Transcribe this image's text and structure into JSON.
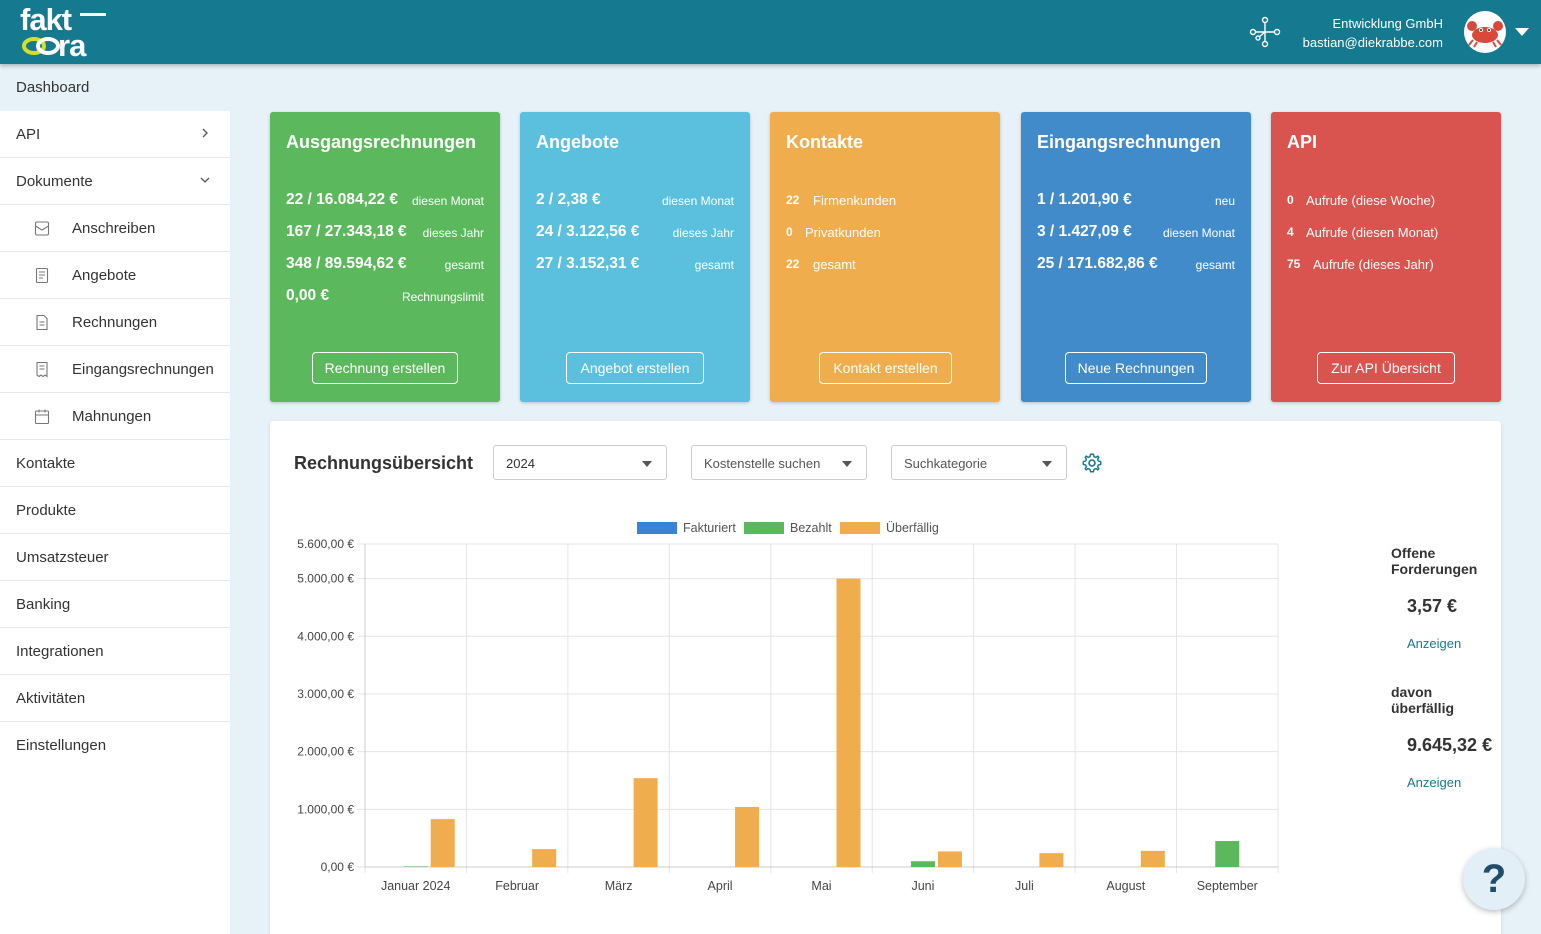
{
  "brand": {
    "logo_top": "fakt",
    "logo_bottom": "ra"
  },
  "header": {
    "company": "Entwicklung GmbH",
    "email": "bastian@diekrabbe.com"
  },
  "sidebar": {
    "dashboard": "Dashboard",
    "api": "API",
    "dokumente": "Dokumente",
    "sub": [
      "Anschreiben",
      "Angebote",
      "Rechnungen",
      "Eingangsrechnungen",
      "Mahnungen"
    ],
    "items": [
      "Kontakte",
      "Produkte",
      "Umsatzsteuer",
      "Banking",
      "Integrationen",
      "Aktivitäten",
      "Einstellungen"
    ]
  },
  "cards": {
    "ausgang": {
      "title": "Ausgangsrechnungen",
      "rows": [
        {
          "value": "22 / 16.084,22 €",
          "label": "diesen Monat"
        },
        {
          "value": "167 / 27.343,18 €",
          "label": "dieses Jahr"
        },
        {
          "value": "348 / 89.594,62 €",
          "label": "gesamt"
        },
        {
          "value": "0,00 €",
          "label": "Rechnungslimit"
        }
      ],
      "button": "Rechnung erstellen",
      "color": "#5cb85c"
    },
    "angebote": {
      "title": "Angebote",
      "rows": [
        {
          "value": "2 / 2,38 €",
          "label": "diesen Monat"
        },
        {
          "value": "24 / 3.122,56 €",
          "label": "dieses Jahr"
        },
        {
          "value": "27 / 3.152,31 €",
          "label": "gesamt"
        }
      ],
      "button": "Angebot erstellen",
      "color": "#5bc0de"
    },
    "kontakte": {
      "title": "Kontakte",
      "rows": [
        {
          "value": "22",
          "label": "Firmenkunden"
        },
        {
          "value": "0",
          "label": "Privatkunden"
        },
        {
          "value": "22",
          "label": "gesamt"
        }
      ],
      "button": "Kontakt erstellen",
      "color": "#f0ad4e"
    },
    "eingang": {
      "title": "Eingangsrechnungen",
      "rows": [
        {
          "value": "1 / 1.201,90 €",
          "label": "neu"
        },
        {
          "value": "3 / 1.427,09 €",
          "label": "diesen Monat"
        },
        {
          "value": "25 / 171.682,86 €",
          "label": "gesamt"
        }
      ],
      "button": "Neue Rechnungen",
      "color": "#428bca"
    },
    "api": {
      "title": "API",
      "rows": [
        {
          "value": "0",
          "label": "Aufrufe (diese Woche)"
        },
        {
          "value": "4",
          "label": "Aufrufe (diesen Monat)"
        },
        {
          "value": "75",
          "label": "Aufrufe (dieses Jahr)"
        }
      ],
      "button": "Zur API Übersicht",
      "color": "#d9534f"
    }
  },
  "panel": {
    "title": "Rechnungsübersicht",
    "year_select": "2024",
    "cost_placeholder": "Kostenstelle suchen",
    "category_placeholder": "Suchkategorie"
  },
  "summary": {
    "open_label": "Offene Forderungen",
    "open_value": "3,57 €",
    "open_link": "Anzeigen",
    "overdue_label": "davon überfällig",
    "overdue_value": "9.645,32 €",
    "overdue_link": "Anzeigen"
  },
  "help": "?",
  "chart_data": {
    "type": "bar",
    "categories": [
      "Januar 2024",
      "Februar",
      "März",
      "April",
      "Mai",
      "Juni",
      "Juli",
      "August",
      "September"
    ],
    "series": [
      {
        "name": "Fakturiert",
        "color": "#3a82d6",
        "values": [
          0,
          0,
          0,
          0,
          0,
          0,
          0,
          0,
          0
        ]
      },
      {
        "name": "Bezahlt",
        "color": "#5cb85c",
        "values": [
          10,
          0,
          0,
          0,
          0,
          100,
          0,
          0,
          450
        ]
      },
      {
        "name": "Überfällig",
        "color": "#f0ad4e",
        "values": [
          830,
          310,
          1540,
          1040,
          5000,
          270,
          240,
          280,
          0
        ]
      }
    ],
    "y_ticks": [
      "0,00 €",
      "1.000,00 €",
      "2.000,00 €",
      "3.000,00 €",
      "4.000,00 €",
      "5.000,00 €",
      "5.600,00 €"
    ],
    "y_tick_values": [
      0,
      1000,
      2000,
      3000,
      4000,
      5000,
      5600
    ],
    "ylim": [
      0,
      5600
    ],
    "legend": "top",
    "grid": true
  }
}
